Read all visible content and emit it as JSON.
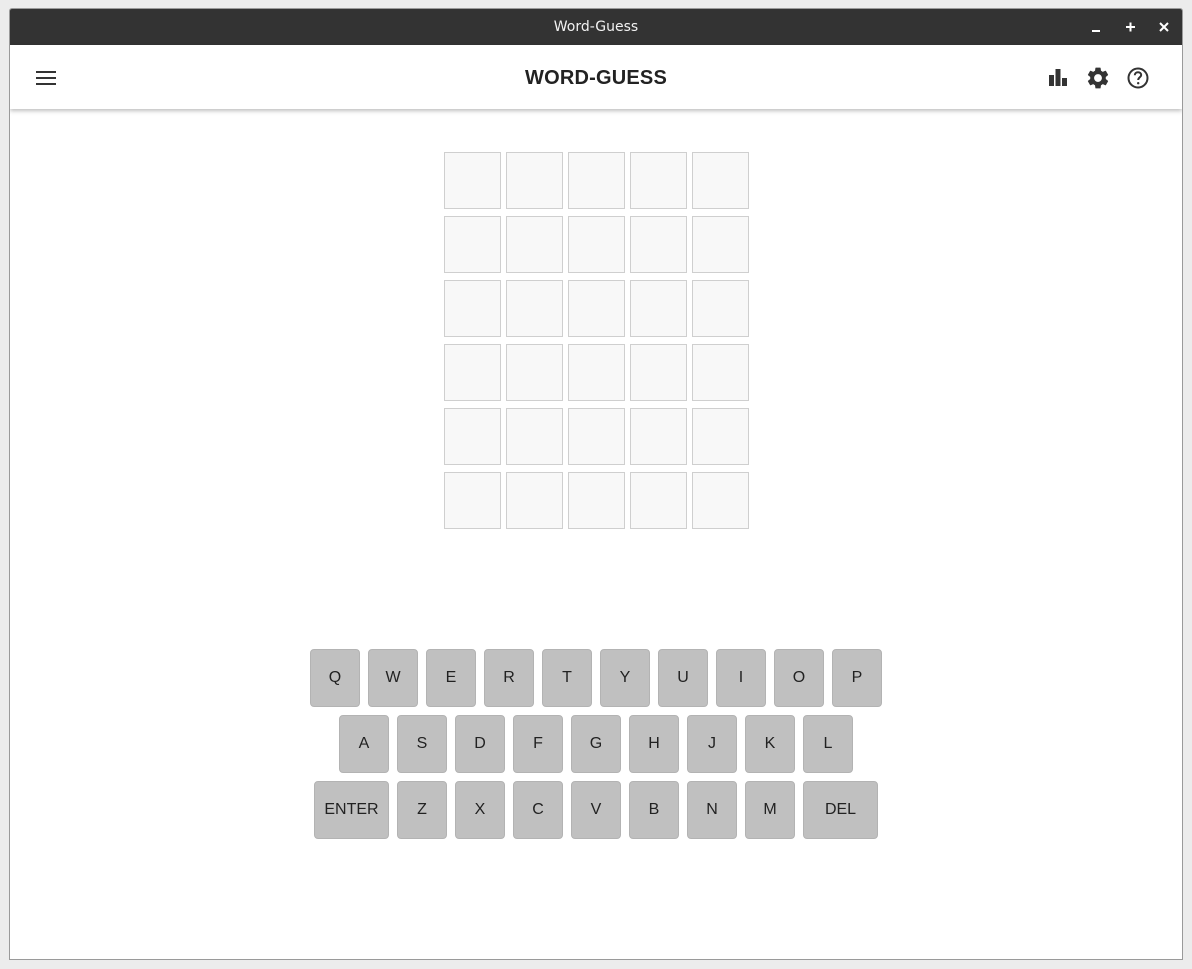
{
  "window": {
    "title": "Word-Guess",
    "controls": [
      "minimize-icon",
      "maximize-icon",
      "close-icon"
    ]
  },
  "appbar": {
    "title": "WORD-GUESS",
    "left_icon": "menu-icon",
    "right_icons": [
      "stats-icon",
      "settings-icon",
      "help-icon"
    ]
  },
  "board": {
    "rows": [
      [
        "",
        "",
        "",
        "",
        ""
      ],
      [
        "",
        "",
        "",
        "",
        ""
      ],
      [
        "",
        "",
        "",
        "",
        ""
      ],
      [
        "",
        "",
        "",
        "",
        ""
      ],
      [
        "",
        "",
        "",
        "",
        ""
      ],
      [
        "",
        "",
        "",
        "",
        ""
      ]
    ]
  },
  "keyboard": {
    "rows": [
      [
        "Q",
        "W",
        "E",
        "R",
        "T",
        "Y",
        "U",
        "I",
        "O",
        "P"
      ],
      [
        "A",
        "S",
        "D",
        "F",
        "G",
        "H",
        "J",
        "K",
        "L"
      ],
      [
        "ENTER",
        "Z",
        "X",
        "C",
        "V",
        "B",
        "N",
        "M",
        "DEL"
      ]
    ]
  },
  "colors": {
    "titlebar": "#333333",
    "key": "#c0c0c0",
    "tile_border": "#cfcfcf"
  }
}
